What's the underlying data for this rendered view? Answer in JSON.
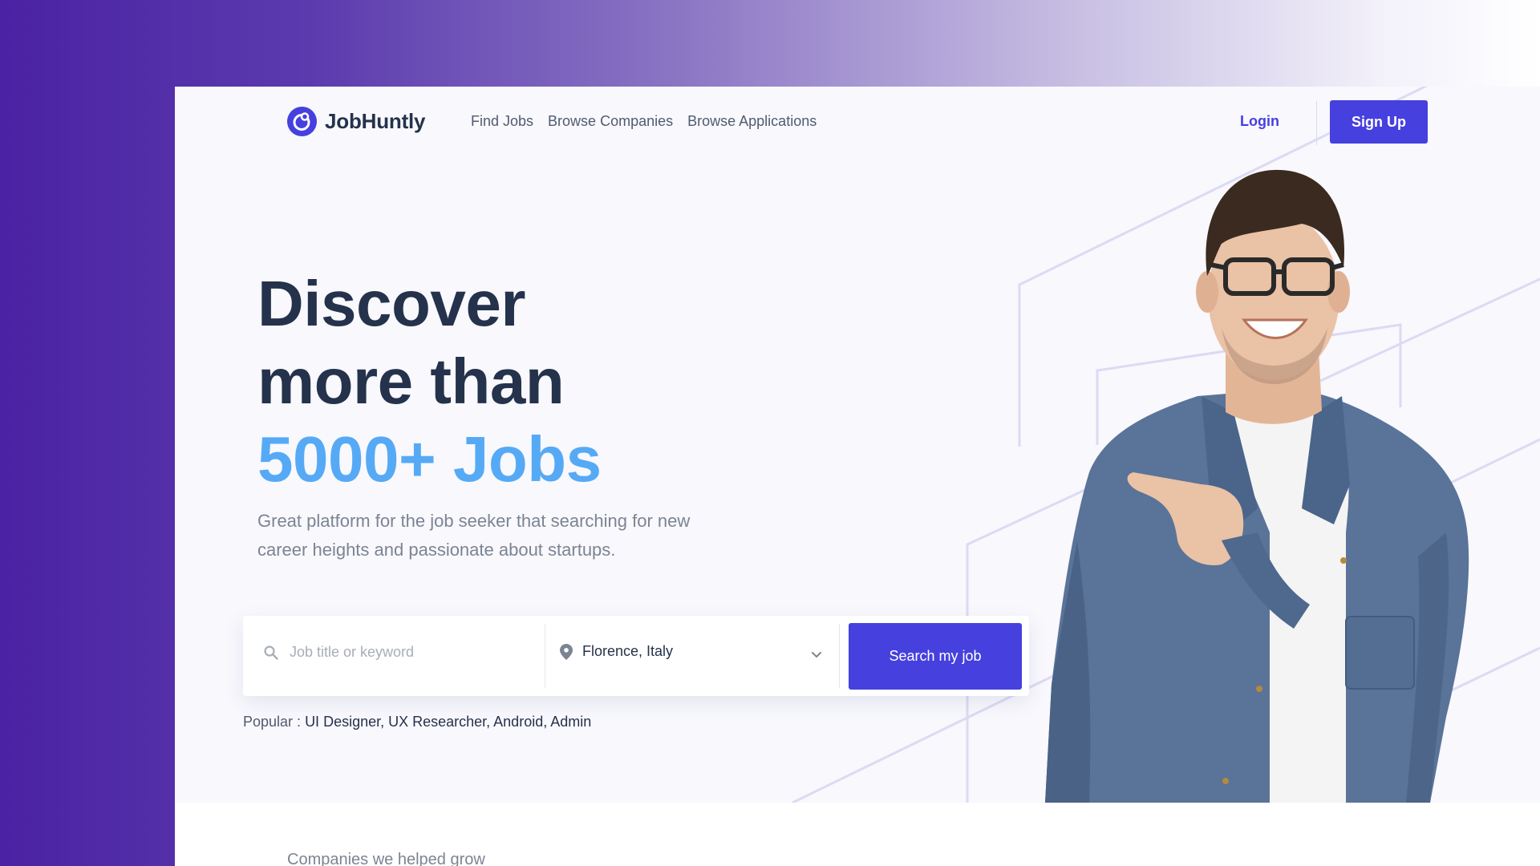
{
  "brand": {
    "name": "JobHuntly",
    "color": "#4640de"
  },
  "nav": {
    "items": [
      "Find Jobs",
      "Browse Companies",
      "Browse Applications"
    ],
    "login": "Login",
    "signup": "Sign Up"
  },
  "hero": {
    "line1": "Discover",
    "line2": "more than",
    "line3": "5000+ Jobs",
    "subtitle": "Great platform for the job seeker that searching for new career heights and passionate about startups.",
    "accent_color": "#56aaf5"
  },
  "search": {
    "placeholder": "Job title or keyword",
    "location": "Florence, Italy",
    "button": "Search my job"
  },
  "popular": {
    "label": "Popular :",
    "items": "UI Designer, UX Researcher, Android, Admin"
  },
  "companies": {
    "label": "Companies we helped grow"
  },
  "icons": {
    "logo": "logo-icon",
    "search": "search-icon",
    "location": "location-pin-icon",
    "dropdown": "chevron-down-icon"
  }
}
